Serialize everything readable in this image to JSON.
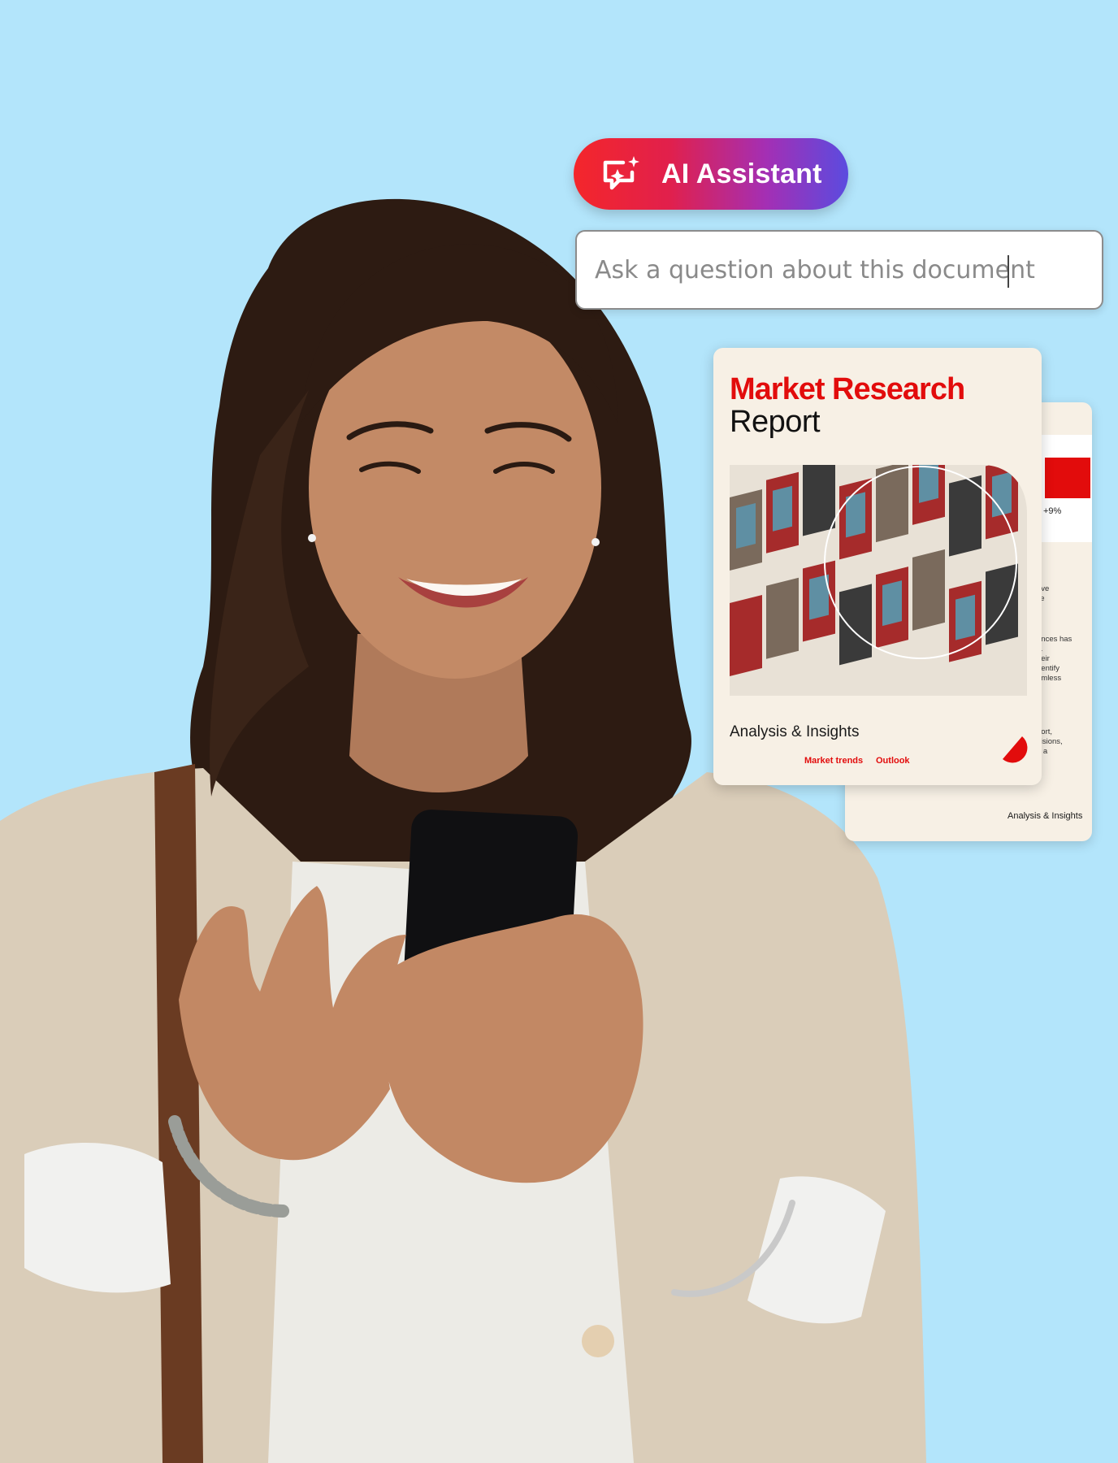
{
  "colors": {
    "background": "#b3e5fb",
    "brand_red": "#e20c0c",
    "pill_gradient": [
      "#f4262b",
      "#e1204c",
      "#a42fb4",
      "#5b4bdf"
    ],
    "card_bg": "#f7f0e5"
  },
  "ai_assistant": {
    "label": "AI Assistant",
    "icon": "ai-chat-sparkle-icon"
  },
  "ask": {
    "placeholder": "Ask a question about this document"
  },
  "report_card": {
    "title_line1": "Market Research",
    "title_line2": "Report",
    "subtitle": "Analysis & Insights",
    "nav": [
      "Market trends",
      "Outlook"
    ]
  },
  "back_card": {
    "stat": "+9%",
    "snippets": [
      "rive",
      "ile",
      "n",
      "ences has",
      "s.",
      "heir",
      "dentify",
      "amless",
      "d",
      "port,",
      "cisions,",
      "n a"
    ],
    "footer": "Analysis & Insights"
  }
}
